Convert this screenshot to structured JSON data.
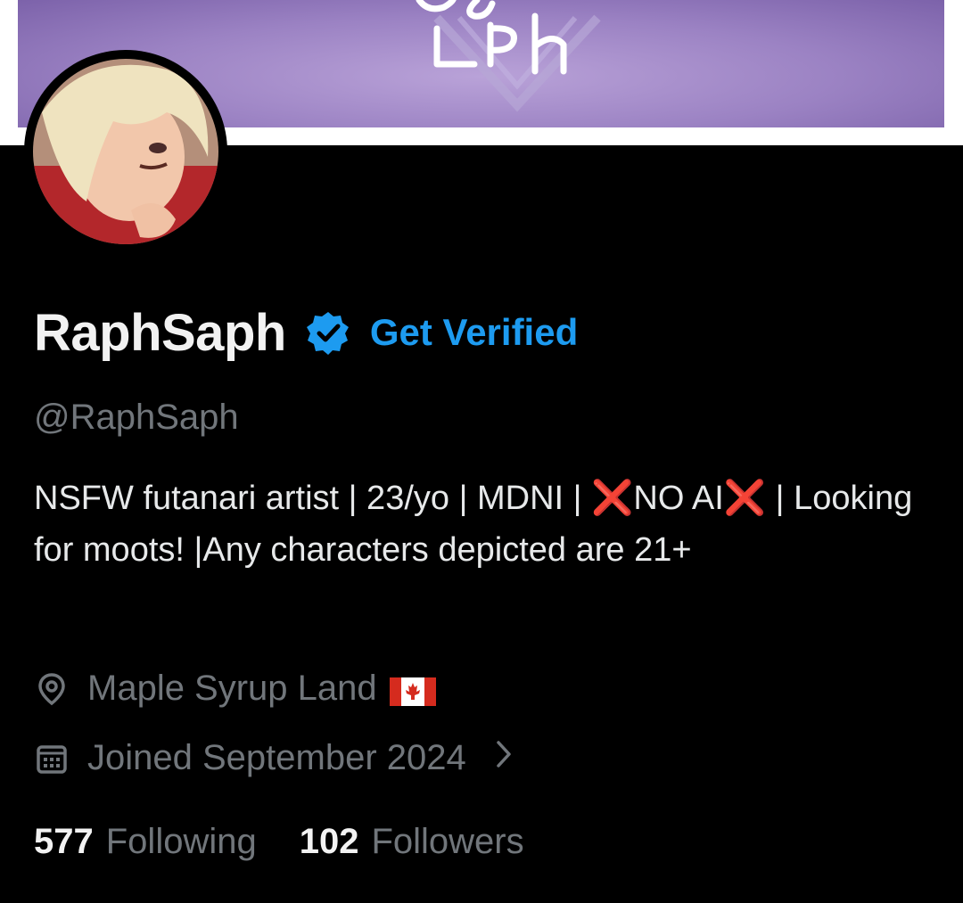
{
  "profile": {
    "display_name": "RaphSaph",
    "get_verified_label": "Get Verified",
    "handle": "@RaphSaph",
    "bio": {
      "part1": "NSFW futanari artist | 23/yo | MDNI | ",
      "x1": "❌",
      "part2": "NO AI",
      "x2": "❌",
      "part3": " | Looking for moots! |Any characters depicted are 21+"
    },
    "location": "Maple Syrup Land",
    "joined": "Joined September 2024",
    "following_count": "577",
    "following_label": "Following",
    "followers_count": "102",
    "followers_label": "Followers"
  },
  "banner_text": "Saph",
  "icons": {
    "verified": "verified-badge-icon",
    "location": "map-pin-icon",
    "calendar": "calendar-icon",
    "flag": "canada-flag-icon",
    "chevron": "chevron-right-icon"
  },
  "colors": {
    "accent": "#1d9bf0",
    "background": "#000000",
    "muted": "#71767b",
    "banner": "#9b82c3",
    "x_mark": "#e0262d"
  }
}
